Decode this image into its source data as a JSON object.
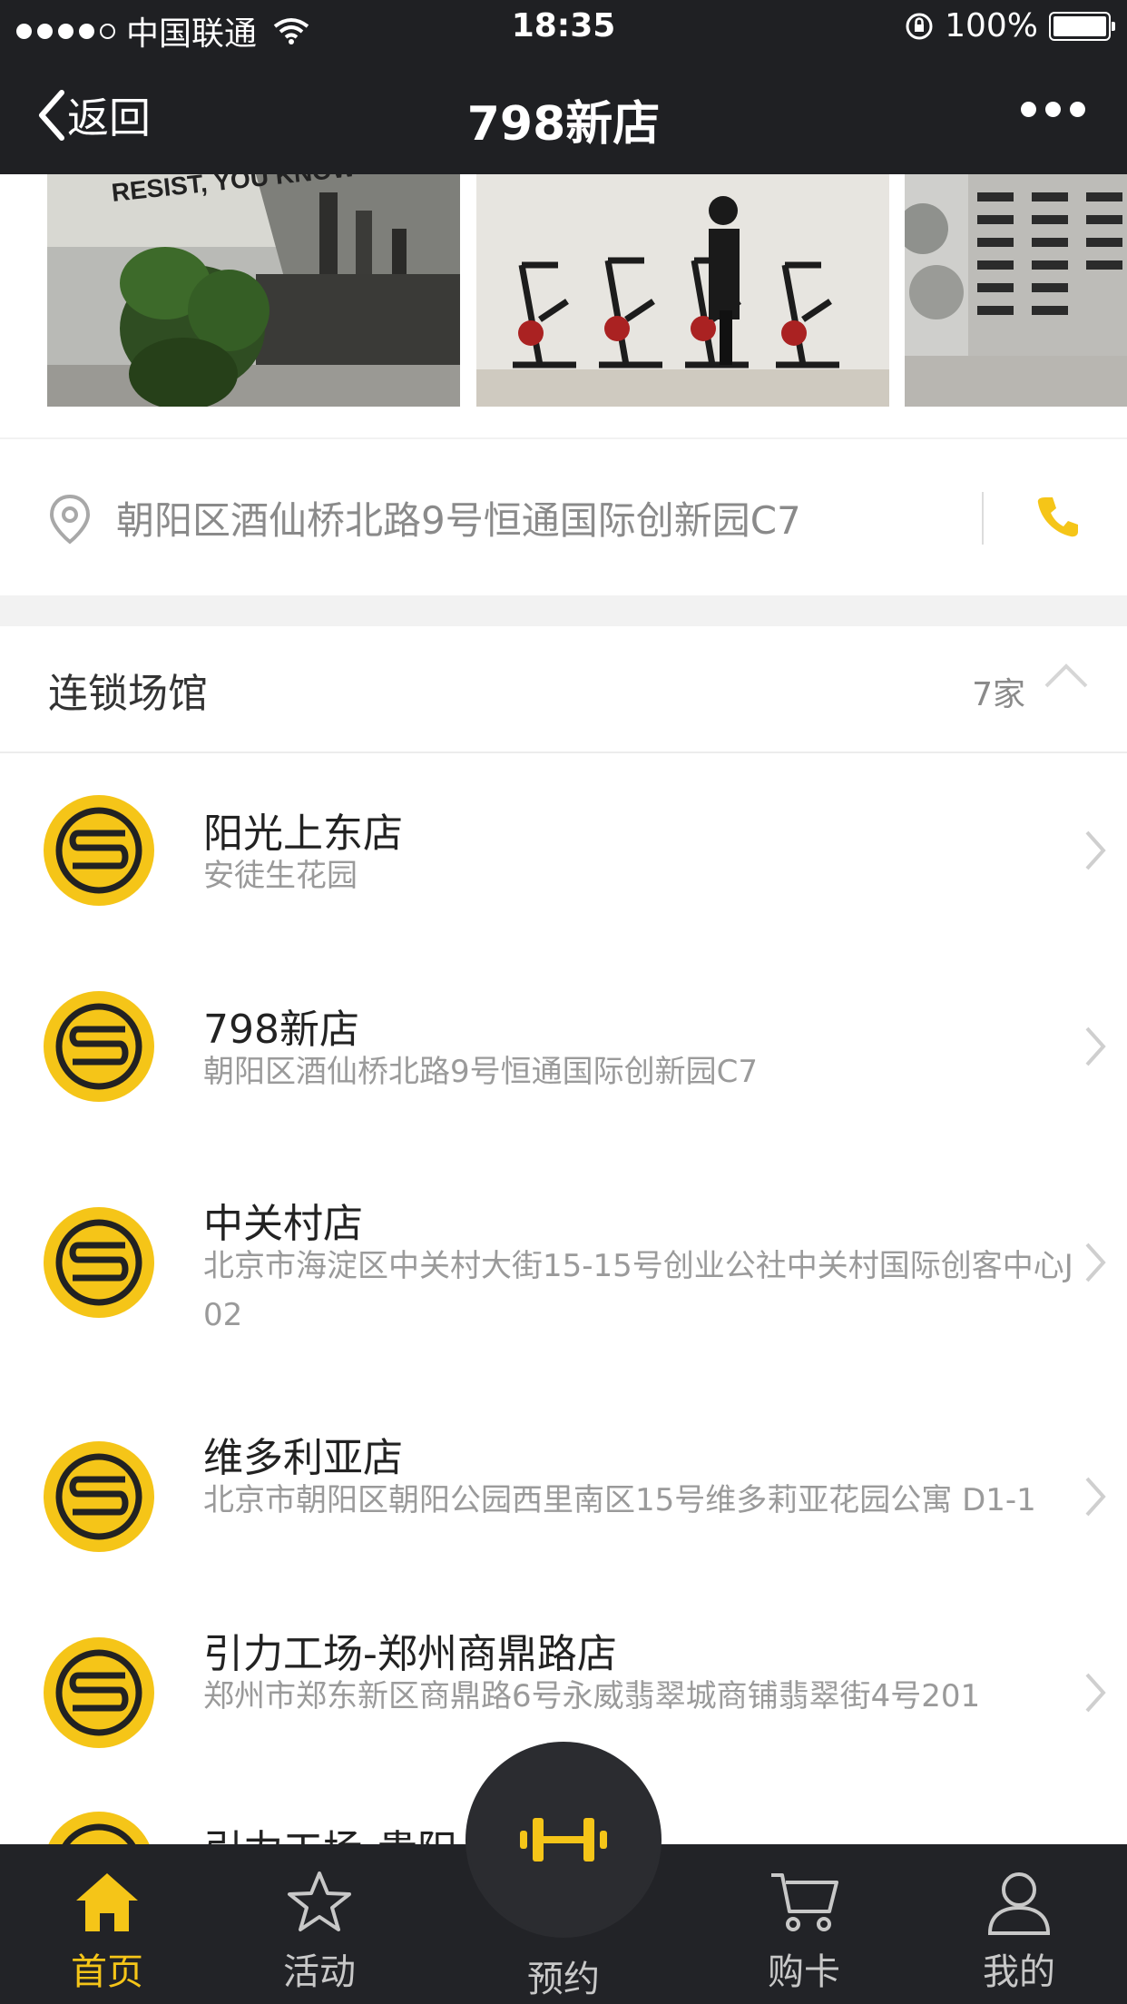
{
  "status_bar": {
    "carrier": "中国联通",
    "time": "18:35",
    "battery": "100%",
    "battery_level": 1.0
  },
  "nav": {
    "back_label": "返回",
    "title": "798新店"
  },
  "store": {
    "address": "朝阳区酒仙桥北路9号恒通国际创新园C7",
    "photo_sign_text": "RESIST, YOU KNOW"
  },
  "chain": {
    "title": "连锁场馆",
    "count": "7家",
    "items": [
      {
        "name": "阳光上东店",
        "address": "安徒生花园"
      },
      {
        "name": "798新店",
        "address": "朝阳区酒仙桥北路9号恒通国际创新园C7"
      },
      {
        "name": "中关村店",
        "address": "北京市海淀区中关村大街15-15号创业公社中关村国际创客中心J02"
      },
      {
        "name": "维多利亚店",
        "address": "北京市朝阳区朝阳公园西里南区15号维多莉亚花园公寓 D1-1"
      },
      {
        "name": "引力工场-郑州商鼎路店",
        "address": "郑州市郑东新区商鼎路6号永威翡翠城商铺翡翠街4号201"
      },
      {
        "name": "引力工场-贵阳",
        "address": ""
      }
    ]
  },
  "tabbar": {
    "home": "首页",
    "activity": "活动",
    "book": "预约",
    "cart": "购卡",
    "mine": "我的"
  },
  "colors": {
    "accent": "#f5c518",
    "dark_bg": "#1f2023",
    "tab_bg": "#222327"
  },
  "icons": [
    "location-pin-icon",
    "phone-icon",
    "chevron-up-icon",
    "chevron-right-icon",
    "home-icon",
    "star-icon",
    "dumbbell-icon",
    "cart-icon",
    "user-icon",
    "brand-logo-icon"
  ]
}
